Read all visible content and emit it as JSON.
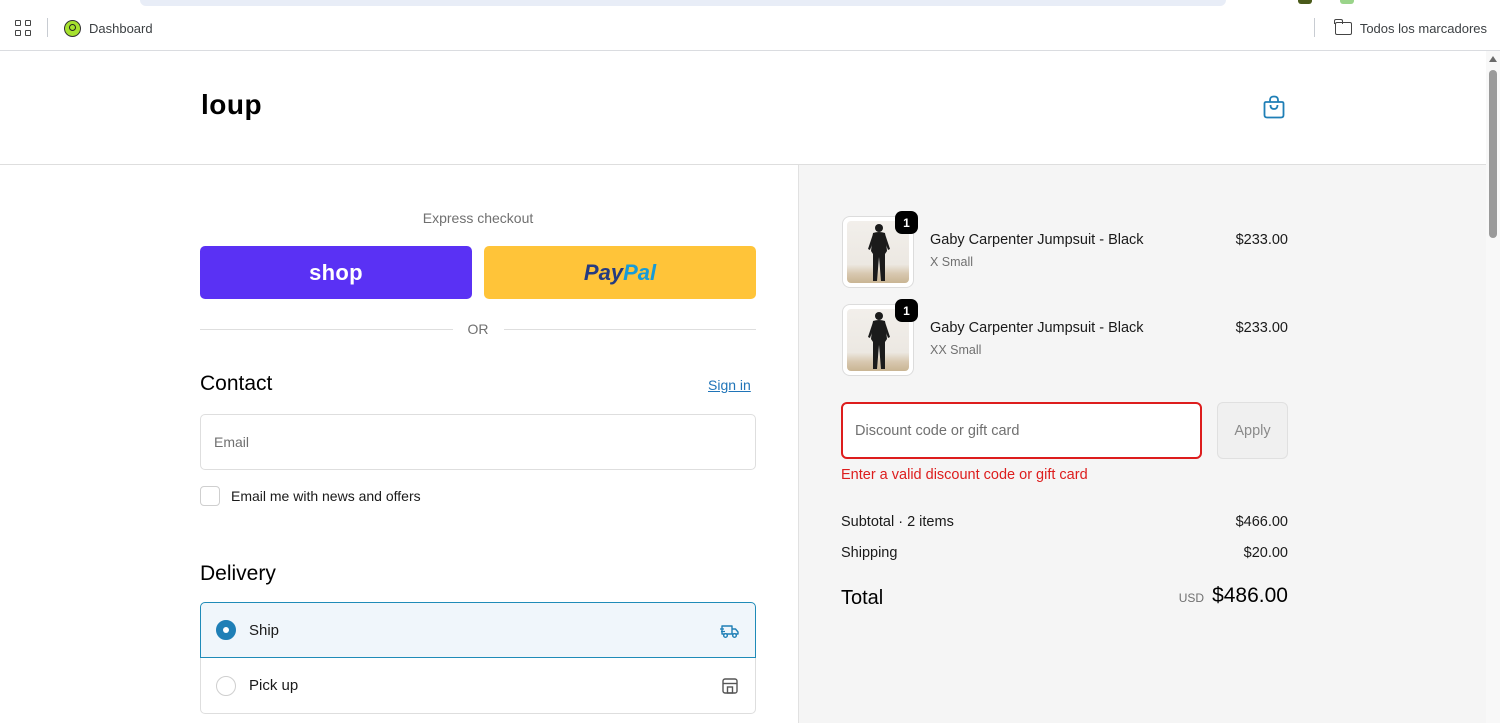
{
  "browser": {
    "bookmarks": [
      {
        "label": "Dashboard",
        "icon": "dashboard-favicon-icon"
      }
    ],
    "all_bookmarks_label": "Todos los marcadores"
  },
  "store": {
    "logo": "loup",
    "cart_icon": "shopping-bag-icon",
    "accent_color": "#1f7fb6"
  },
  "checkout": {
    "express_label": "Express checkout",
    "shop_pay_label": "shop",
    "paypal_label": {
      "part1": "Pay",
      "part2": "Pal"
    },
    "or_label": "OR",
    "contact": {
      "title": "Contact",
      "sign_in": "Sign in",
      "email_placeholder": "Email",
      "email_value": "",
      "news_checkbox_label": "Email me with news and offers",
      "news_checked": false
    },
    "delivery": {
      "title": "Delivery",
      "options": [
        {
          "label": "Ship",
          "selected": true,
          "icon": "truck-icon"
        },
        {
          "label": "Pick up",
          "selected": false,
          "icon": "store-icon"
        }
      ]
    }
  },
  "summary": {
    "items": [
      {
        "name": "Gaby Carpenter Jumpsuit - Black",
        "variant": "X Small",
        "price": "$233.00",
        "quantity": "1"
      },
      {
        "name": "Gaby Carpenter Jumpsuit - Black",
        "variant": "XX Small",
        "price": "$233.00",
        "quantity": "1"
      }
    ],
    "discount": {
      "placeholder": "Discount code or gift card",
      "value": "",
      "apply_label": "Apply",
      "error": "Enter a valid discount code or gift card",
      "error_color": "#dd1d1d"
    },
    "subtotal_label": "Subtotal · 2 items",
    "subtotal_value": "$466.00",
    "shipping_label": "Shipping",
    "shipping_value": "$20.00",
    "total_label": "Total",
    "currency": "USD",
    "total_value": "$486.00"
  }
}
